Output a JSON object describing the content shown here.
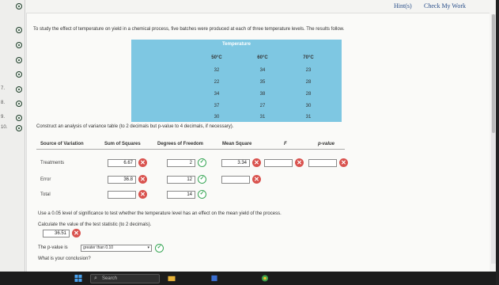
{
  "topbar": {
    "hint_label": "Hint(s)",
    "check_label": "Check My Work"
  },
  "sidebar": {
    "items": [
      {
        "num": ""
      },
      {
        "num": ""
      },
      {
        "num": ""
      },
      {
        "num": ""
      },
      {
        "num": ""
      },
      {
        "num": "7."
      },
      {
        "num": "8."
      },
      {
        "num": "9."
      },
      {
        "num": "10."
      }
    ]
  },
  "problem": {
    "prompt": "To study the effect of temperature on yield in a chemical process, five batches were produced at each of three temperature levels. The results follow.",
    "table_title": "Temperature",
    "columns": [
      "50°C",
      "60°C",
      "70°C"
    ],
    "rows": [
      [
        "32",
        "34",
        "23"
      ],
      [
        "22",
        "35",
        "28"
      ],
      [
        "34",
        "38",
        "28"
      ],
      [
        "37",
        "27",
        "30"
      ],
      [
        "30",
        "31",
        "31"
      ]
    ],
    "instruction": "Construct an analysis of variance table (to 2 decimals but p-value to 4 decimals, if necessary)."
  },
  "anova": {
    "headers": [
      "Source of Variation",
      "Sum of Squares",
      "Degrees of Freedom",
      "Mean Square",
      "F",
      "p-value"
    ],
    "treatments": {
      "label": "Treatments",
      "ss": "6.67",
      "df": "2",
      "ms": "3.34",
      "f": "",
      "p": ""
    },
    "error": {
      "label": "Error",
      "ss": "36.8",
      "df": "12",
      "ms": ""
    },
    "total": {
      "label": "Total",
      "ss": "",
      "df": "14"
    }
  },
  "followup": {
    "q1": "Use a 0.05 level of significance to test whether the temperature level has an effect on the mean yield of the process.",
    "q2": "Calculate the value of the test statistic (to 2 decimals).",
    "stat_value": "36.51",
    "pval_prefix": "The p-value is",
    "pval_select": "greater than 0.10",
    "q3": "What is your conclusion?"
  },
  "taskbar": {
    "search_placeholder": "Search"
  },
  "colors": {
    "table_bg": "#7ec7e2",
    "wrong": "#d9534f",
    "right": "#3aa757"
  }
}
